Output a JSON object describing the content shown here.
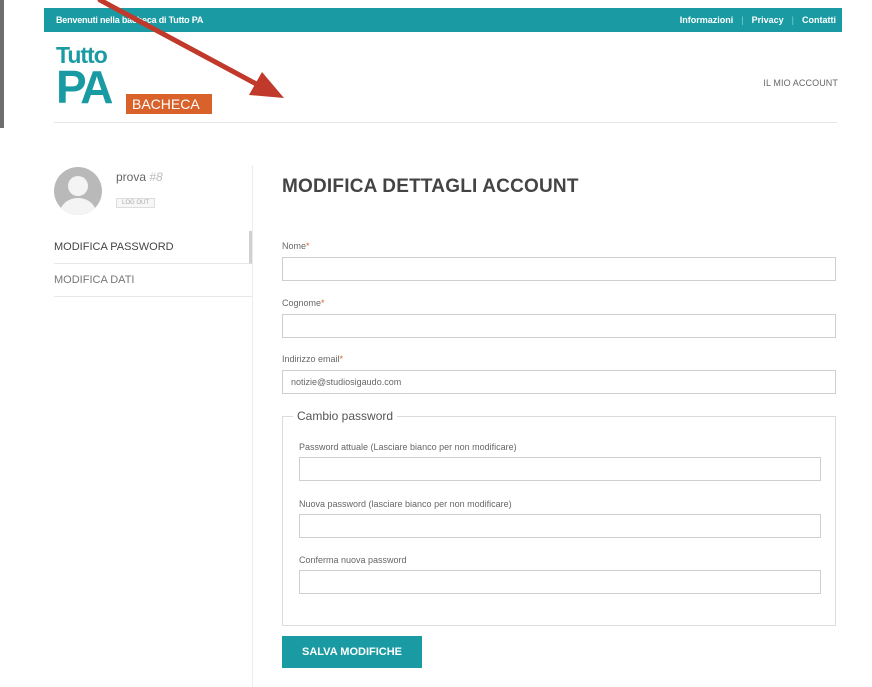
{
  "topbar": {
    "welcome": "Benvenuti nella bacheca di Tutto PA",
    "links": [
      "Informazioni",
      "Privacy",
      "Contatti"
    ]
  },
  "logo": {
    "line1": "Tutto",
    "line2": "PA",
    "tag": "BACHECA"
  },
  "header": {
    "account_link": "IL MIO ACCOUNT"
  },
  "sidebar": {
    "username": "prova",
    "user_id": "#8",
    "logout": "LOG OUT",
    "nav": [
      {
        "label": "MODIFICA PASSWORD",
        "active": true
      },
      {
        "label": "MODIFICA DATI",
        "active": false
      }
    ]
  },
  "form": {
    "title": "MODIFICA DETTAGLI ACCOUNT",
    "required_mark": "*",
    "nome_label": "Nome",
    "nome_value": "",
    "cognome_label": "Cognome",
    "cognome_value": "",
    "email_label": "Indirizzo email",
    "email_value": "notizie@studiosigaudo.com",
    "password_legend": "Cambio password",
    "current_pw_label": "Password attuale (Lasciare bianco per non modificare)",
    "new_pw_label": "Nuova password (lasciare bianco per non modificare)",
    "confirm_pw_label": "Conferma nuova password",
    "save_label": "SALVA MODIFICHE"
  },
  "colors": {
    "accent": "#1a9ba3",
    "brand_orange": "#d9622b",
    "annotation_arrow": "#c0392b"
  }
}
